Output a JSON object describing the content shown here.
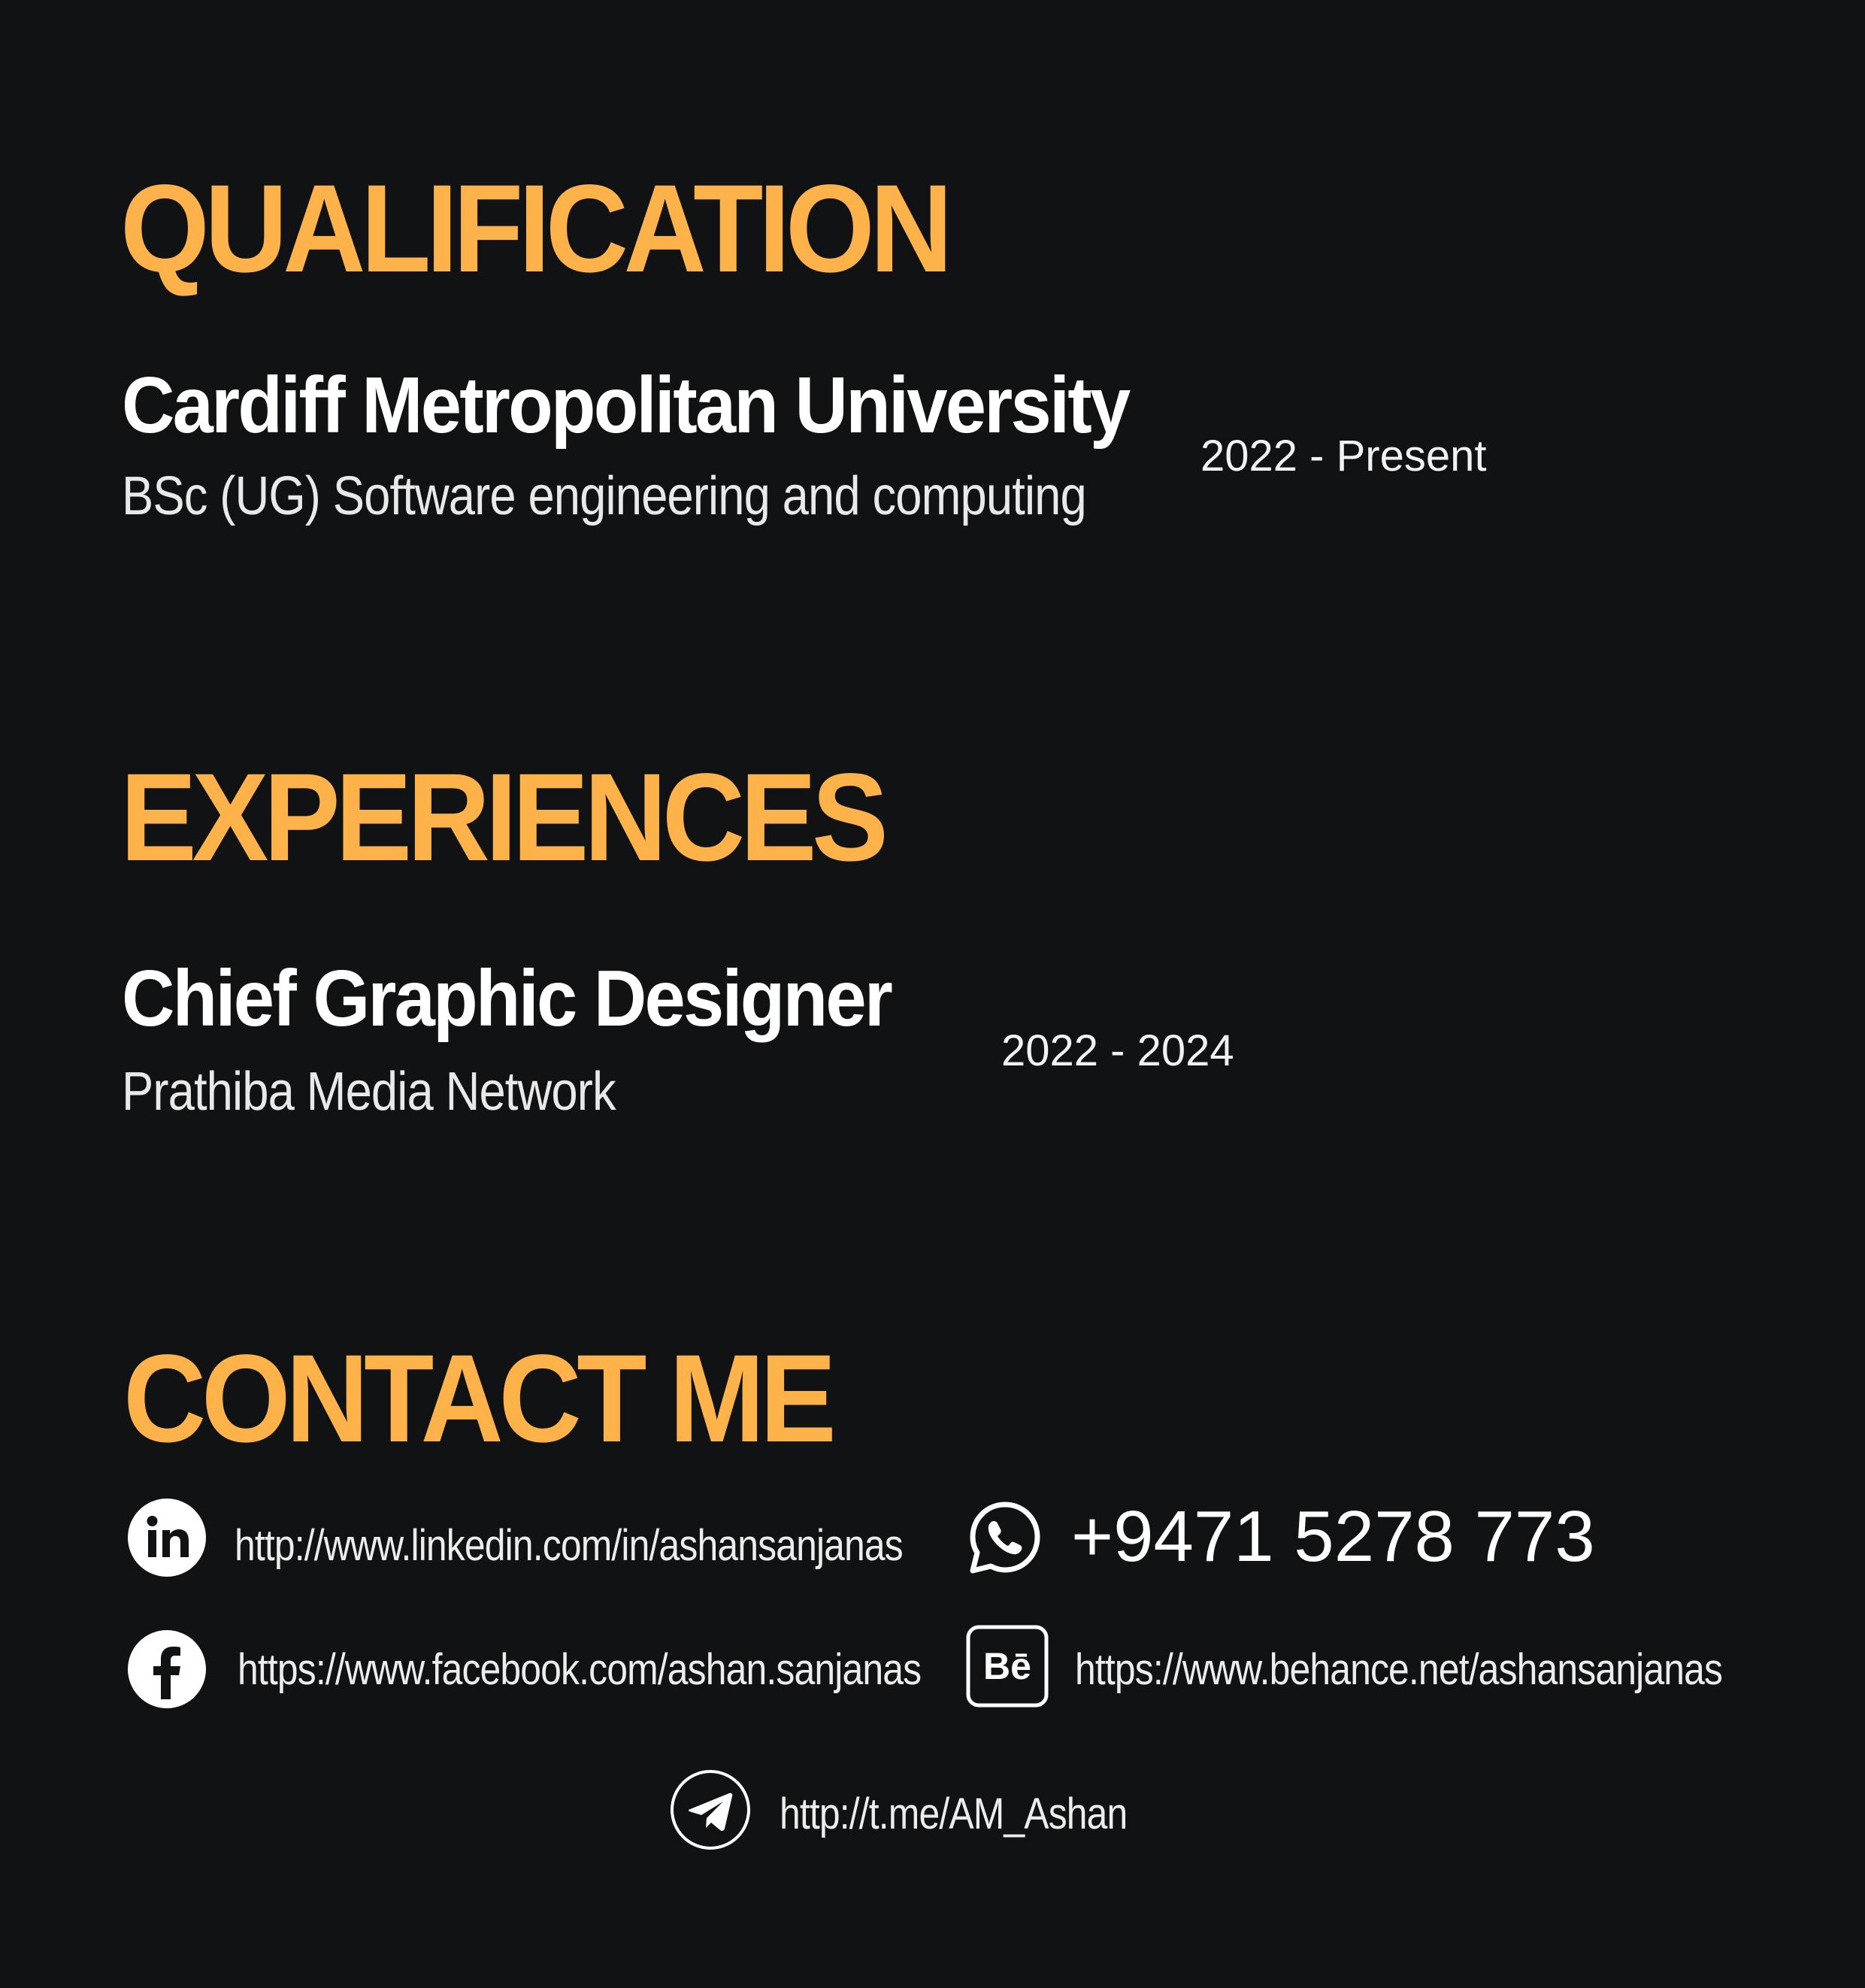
{
  "qualification": {
    "heading": "QUALIFICATION",
    "institution": "Cardiff Metropolitan University",
    "degree": "BSc (UG) Software engineering and computing",
    "period": "2022 - Present"
  },
  "experiences": {
    "heading": "EXPERIENCES",
    "role": "Chief Graphic Designer",
    "company": "Prathiba Media Network",
    "period": "2022 - 2024"
  },
  "contact": {
    "heading": "CONTACT ME",
    "linkedin": {
      "icon": "linkedin-icon",
      "text": "http://www.linkedin.com/in/ashansanjanas"
    },
    "whatsapp": {
      "icon": "whatsapp-icon",
      "text": "+9471 5278 773"
    },
    "facebook": {
      "icon": "facebook-icon",
      "text": "https://www.facebook.com/ashan.sanjanas"
    },
    "behance": {
      "icon": "behance-icon",
      "text": "https://www.behance.net/ashansanjanas"
    },
    "telegram": {
      "icon": "telegram-icon",
      "text": "http://t.me/AM_Ashan"
    }
  },
  "colors": {
    "background": "#111214",
    "accent": "#FDB24A",
    "text": "#FFFFFF"
  }
}
